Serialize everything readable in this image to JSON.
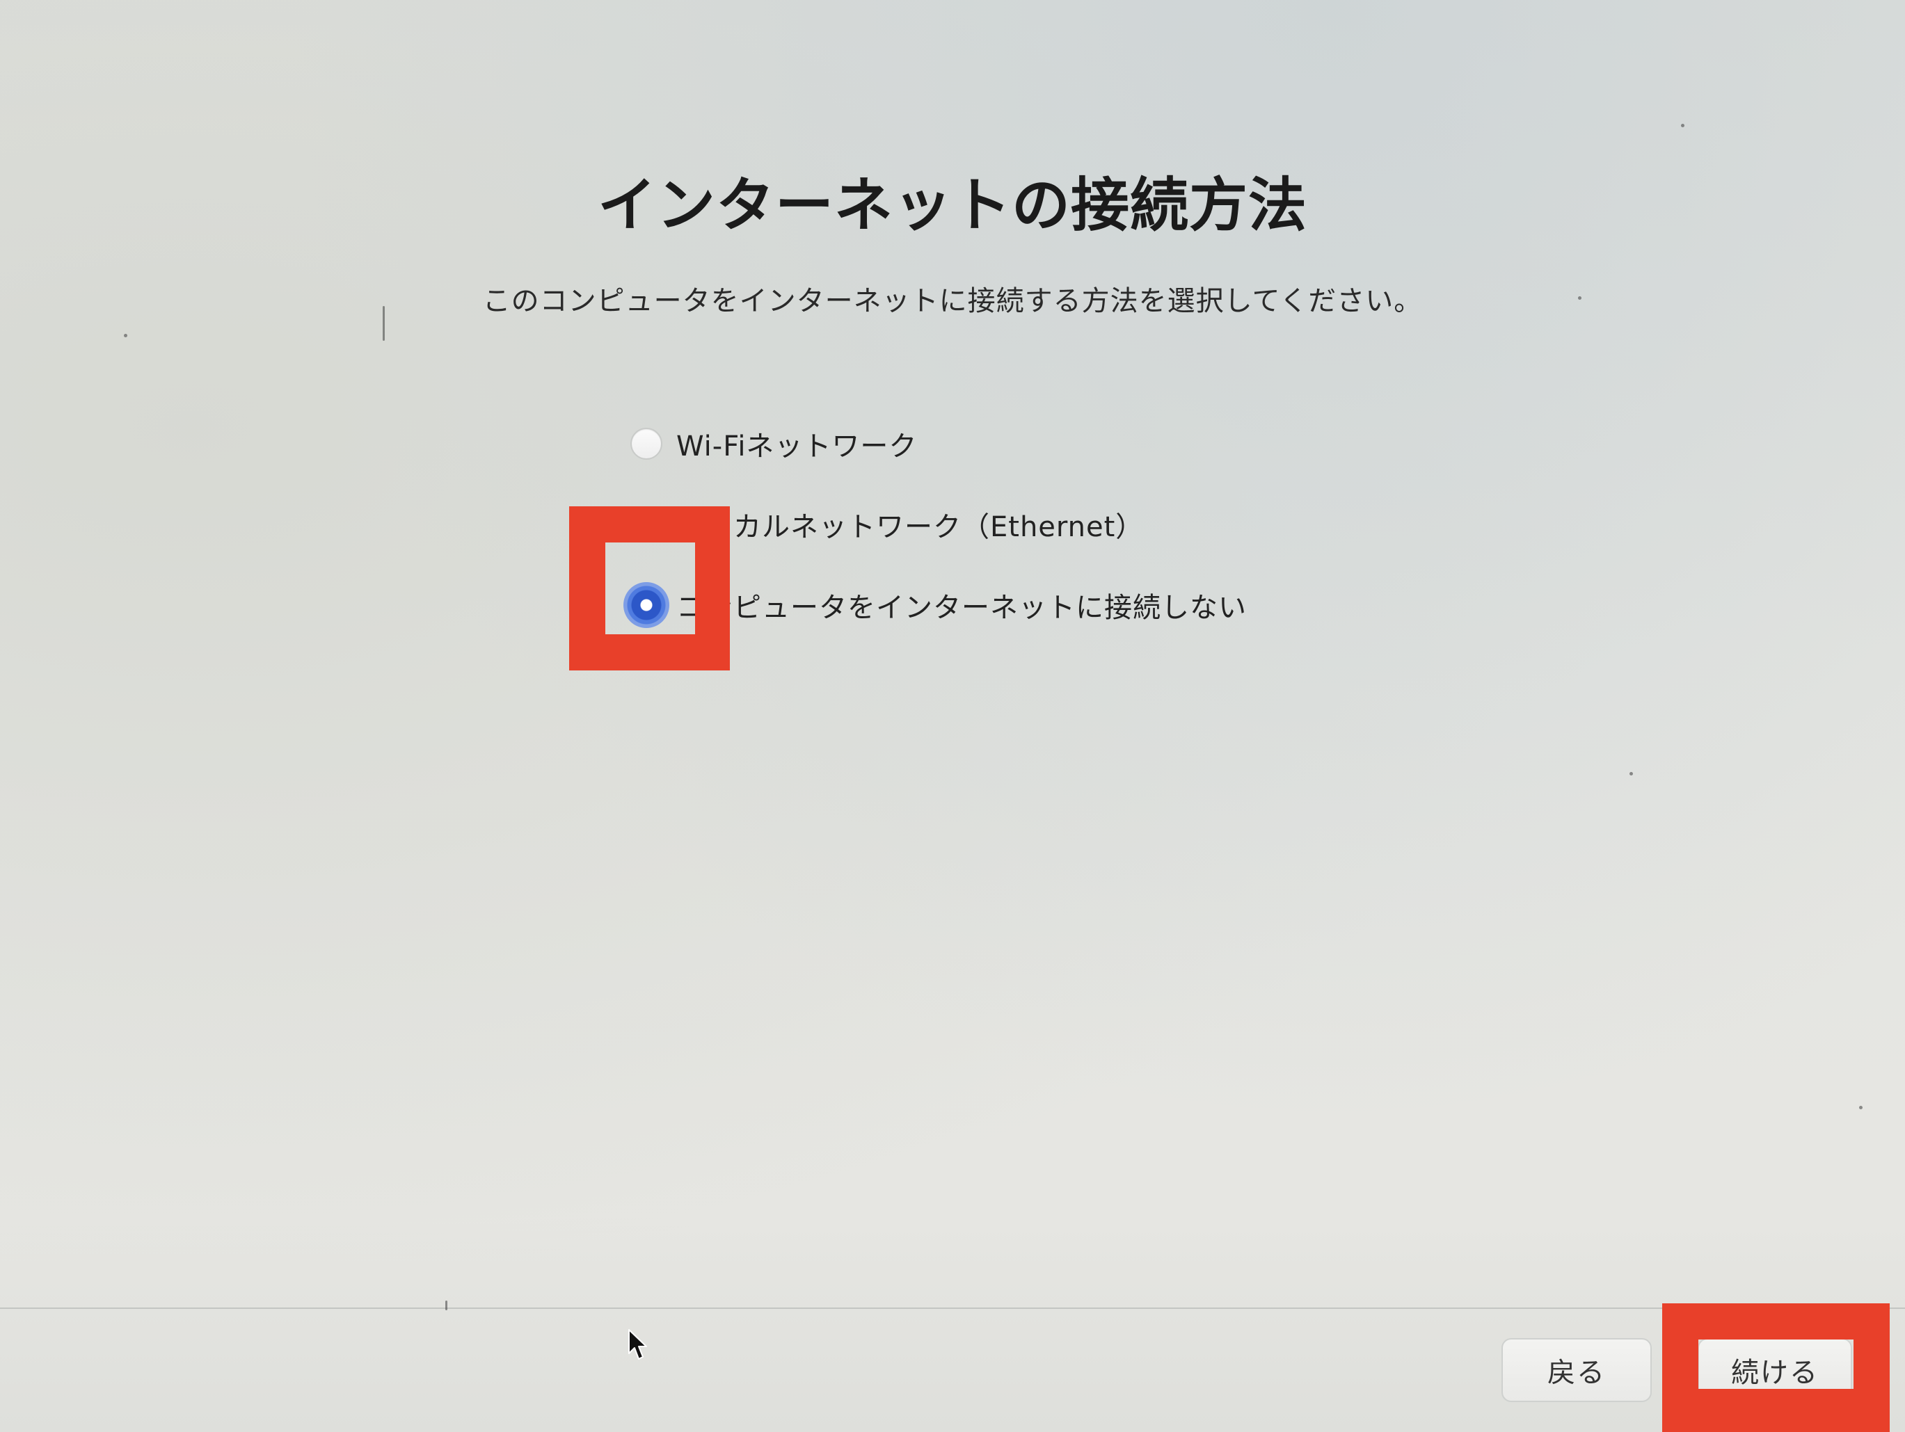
{
  "setup": {
    "title": "インターネットの接続方法",
    "subtitle": "このコンピュータをインターネットに接続する方法を選択してください。",
    "options": [
      {
        "label": "Wi-Fiネットワーク",
        "selected": false
      },
      {
        "label": "ローカルネットワーク（Ethernet）",
        "selected": false
      },
      {
        "label": "コンピュータをインターネットに接続しない",
        "selected": true
      }
    ]
  },
  "footer": {
    "back_label": "戻る",
    "continue_label": "続ける"
  },
  "highlight_color": "#e8402a",
  "accent_color": "#2c57c8"
}
